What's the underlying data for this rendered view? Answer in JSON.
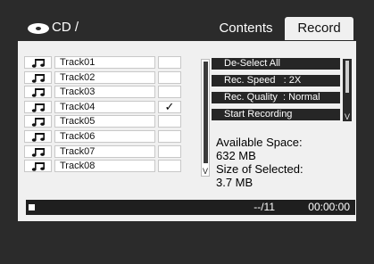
{
  "header": {
    "path": "CD /",
    "tabs": [
      {
        "label": "Contents",
        "selected": false
      },
      {
        "label": "Record",
        "selected": true
      }
    ]
  },
  "tracks": [
    {
      "name": "Track01",
      "checked": ""
    },
    {
      "name": "Track02",
      "checked": ""
    },
    {
      "name": "Track03",
      "checked": ""
    },
    {
      "name": "Track04",
      "checked": "✓"
    },
    {
      "name": "Track05",
      "checked": ""
    },
    {
      "name": "Track06",
      "checked": ""
    },
    {
      "name": "Track07",
      "checked": ""
    },
    {
      "name": "Track08",
      "checked": ""
    }
  ],
  "track_scroll_arrow": "V",
  "options": [
    {
      "label": "De-Select All"
    },
    {
      "label": "Rec. Speed   : 2X"
    },
    {
      "label": "Rec. Quality  : Normal"
    },
    {
      "label": "Start Recording"
    }
  ],
  "options_scroll_arrow": "V",
  "info": {
    "available_label": "Available Space:",
    "available_value": "632 MB",
    "selected_label": "Size of Selected:",
    "selected_value": "3.7 MB"
  },
  "status": {
    "count": "--/11",
    "time": "00:00:00"
  },
  "colors": {
    "background": "#2b2b2b",
    "panel": "#f0f0f0",
    "button": "#262626"
  }
}
